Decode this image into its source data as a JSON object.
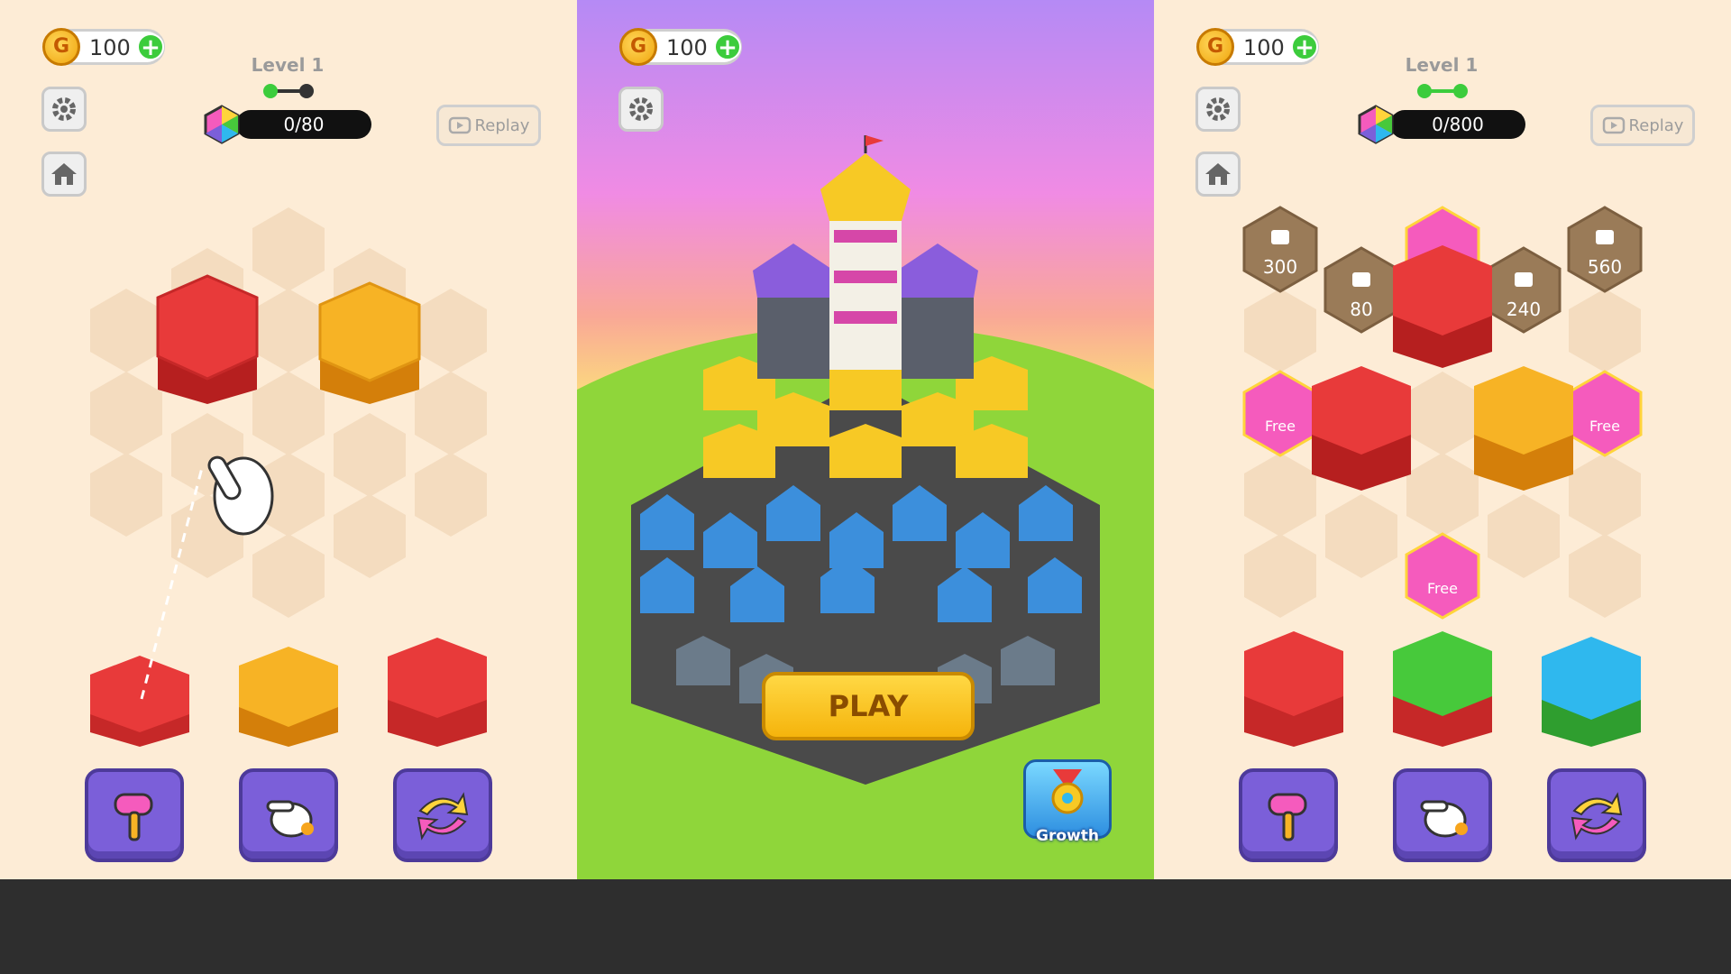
{
  "left_panel": {
    "coins": "100",
    "level_label": "Level 1",
    "progress_text": "0/80",
    "progress_fraction": 0,
    "replay_label": "Replay",
    "icons": [
      "coin-icon",
      "plus-icon",
      "gear-icon",
      "home-icon",
      "rainbow-gem-icon",
      "replay-video-icon",
      "pointer-hand-icon"
    ],
    "tools": [
      "hammer",
      "swap-hand",
      "shuffle"
    ]
  },
  "middle_panel": {
    "coins": "100",
    "play_label": "PLAY",
    "growth_label": "Growth",
    "icons": [
      "coin-icon",
      "plus-icon",
      "gear-icon",
      "growth-medal-icon"
    ]
  },
  "right_panel": {
    "coins": "100",
    "level_label": "Level 1",
    "progress_text": "0/800",
    "progress_fraction": 0,
    "replay_label": "Replay",
    "locked_tiles": [
      "300",
      "80",
      "240",
      "560"
    ],
    "free_tile_label": "Free",
    "tools": [
      "hammer",
      "swap-hand",
      "shuffle"
    ]
  },
  "colors": {
    "red": "#e83a3a",
    "orange": "#f7a51d",
    "green": "#47c93b",
    "blue": "#2fb8ee",
    "board_bg": "#fdecd6",
    "tile_bg": "#f4dcbf",
    "lock_tile": "#9a7b58",
    "free_tile": "#f55bbd"
  }
}
